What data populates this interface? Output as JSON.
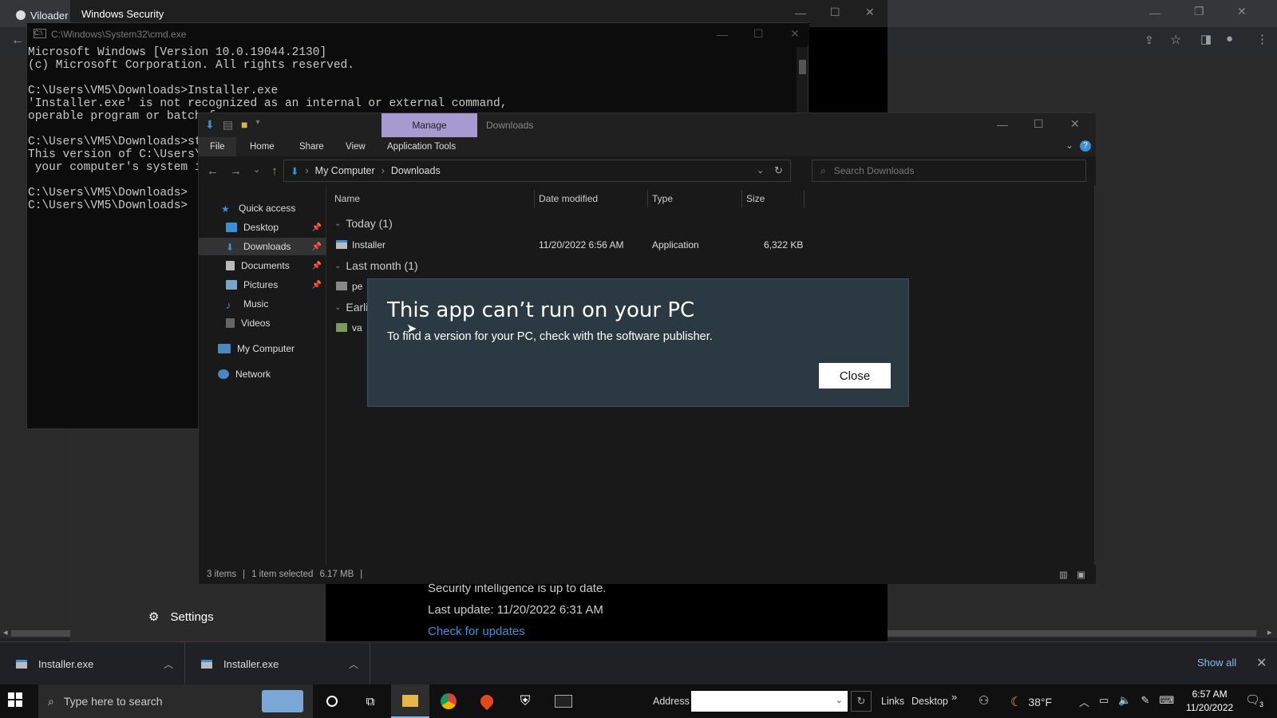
{
  "browser": {
    "tab_title": "Viloader",
    "scroll_left": "◂",
    "scroll_right": "▸"
  },
  "winsec": {
    "title": "Windows Security",
    "settings_label": "Settings",
    "intel_line": "Security intelligence is up to date.",
    "last_update": "Last update: 11/20/2022 6:31 AM",
    "check_link": "Check for updates"
  },
  "cmd": {
    "title": "C:\\Windows\\System32\\cmd.exe",
    "lines": "Microsoft Windows [Version 10.0.19044.2130]\n(c) Microsoft Corporation. All rights reserved.\n\nC:\\Users\\VM5\\Downloads>Installer.exe\n'Installer.exe' is not recognized as an internal or external command,\noperable program or batch f\n\nC:\\Users\\VM5\\Downloads>star\nThis version of C:\\Users\\VM\n your computer's system inf\n\nC:\\Users\\VM5\\Downloads>\nC:\\Users\\VM5\\Downloads>"
  },
  "explorer": {
    "manage_tab": "Manage",
    "window_title": "Downloads",
    "ribbon_tabs": [
      "File",
      "Home",
      "Share",
      "View",
      "Application Tools"
    ],
    "breadcrumb": [
      "My Computer",
      "Downloads"
    ],
    "search_placeholder": "Search Downloads",
    "nav": [
      {
        "label": "Quick access"
      },
      {
        "label": "Desktop"
      },
      {
        "label": "Downloads"
      },
      {
        "label": "Documents"
      },
      {
        "label": "Pictures"
      },
      {
        "label": "Music"
      },
      {
        "label": "Videos"
      },
      {
        "label": "My Computer"
      },
      {
        "label": "Network"
      }
    ],
    "columns": [
      "Name",
      "Date modified",
      "Type",
      "Size"
    ],
    "groups": [
      "Today (1)",
      "Last month (1)",
      "Earlie"
    ],
    "rows": [
      {
        "name": "Installer",
        "date": "11/20/2022 6:56 AM",
        "type": "Application",
        "size": "6,322 KB"
      },
      {
        "name": "pe"
      },
      {
        "name": "va"
      }
    ],
    "status": {
      "items": "3 items",
      "selected": "1 item selected",
      "size": "6.17 MB"
    }
  },
  "dialog": {
    "title": "This app can’t run on your PC",
    "message": "To find a version for your PC, check with the software publisher.",
    "close_label": "Close"
  },
  "downloads_bar": {
    "items": [
      "Installer.exe",
      "Installer.exe"
    ],
    "show_all": "Show all"
  },
  "taskbar": {
    "search_placeholder": "Type here to search",
    "address_label": "Address",
    "links_label": "Links",
    "desktop_label": "Desktop",
    "more": "»",
    "temperature": "38°F",
    "time": "6:57 AM",
    "date": "11/20/2022",
    "notification_count": "3"
  }
}
